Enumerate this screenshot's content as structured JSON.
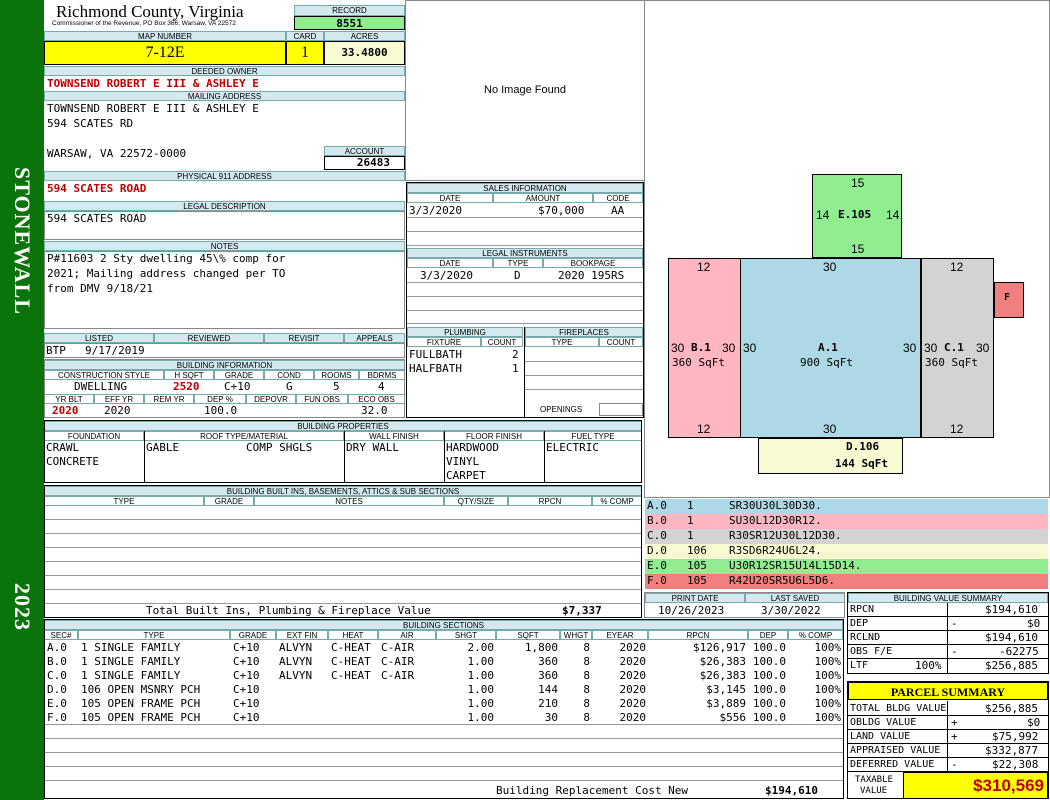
{
  "sidebar": {
    "district": "STONEWALL",
    "year": "2023"
  },
  "header": {
    "county": "Richmond County, Virginia",
    "subtitle": "Commissioner of the Revenue, PO Box 366, Warsaw, VA 22572",
    "record_label": "RECORD",
    "record": "8551",
    "map_label": "MAP NUMBER",
    "map_number": "7-12E",
    "card_label": "CARD",
    "card": "1",
    "acres_label": "ACRES",
    "acres": "33.4800"
  },
  "owner": {
    "deeded_label": "DEEDED OWNER",
    "deeded": "TOWNSEND ROBERT E III & ASHLEY E",
    "mailing_label": "MAILING ADDRESS",
    "mail1": "TOWNSEND ROBERT E III & ASHLEY E",
    "mail2": "594 SCATES RD",
    "mail3": "WARSAW, VA 22572-0000",
    "account_label": "ACCOUNT",
    "account": "26483",
    "phys_label": "PHYSICAL 911 ADDRESS",
    "phys": "594 SCATES ROAD",
    "legal_label": "LEGAL DESCRIPTION",
    "legal": "594 SCATES ROAD",
    "notes_label": "NOTES",
    "notes1": "P#11603 2 Sty dwelling 45\\% comp for",
    "notes2": "2021; Mailing address changed per TO",
    "notes3": "from DMV 9/18/21"
  },
  "image": {
    "text": "No Image Found"
  },
  "sales": {
    "label": "SALES INFORMATION",
    "h_date": "DATE",
    "h_amount": "AMOUNT",
    "h_code": "CODE",
    "date": "3/3/2020",
    "amount": "$70,000",
    "code": "AA"
  },
  "legalinst": {
    "label": "LEGAL INSTRUMENTS",
    "h_date": "DATE",
    "h_type": "TYPE",
    "h_book": "BOOKPAGE",
    "date": "3/3/2020",
    "type": "D",
    "book": "2020 195RS"
  },
  "plumbing": {
    "label": "PLUMBING",
    "h_fixture": "FIXTURE",
    "h_count": "COUNT",
    "r1f": "FULLBATH",
    "r1c": "2",
    "r2f": "HALFBATH",
    "r2c": "1"
  },
  "fireplaces": {
    "label": "FIREPLACES",
    "h_type": "TYPE",
    "h_count": "COUNT",
    "openings": "OPENINGS"
  },
  "visits": {
    "listed_label": "LISTED",
    "reviewed_label": "REVIEWED",
    "revisit_label": "REVISIT",
    "appeals_label": "APPEALS",
    "listed_by": "BTP",
    "listed_date": "9/17/2019"
  },
  "building": {
    "label": "BUILDING INFORMATION",
    "h_style": "CONSTRUCTION STYLE",
    "h_hsqft": "H SQFT",
    "h_grade": "GRADE",
    "h_cond": "COND",
    "h_rooms": "ROOMS",
    "h_bdrms": "BDRMS",
    "style": "DWELLING",
    "hsqft": "2520",
    "grade": "C+10",
    "cond": "G",
    "rooms": "5",
    "bdrms": "4",
    "h_yrblt": "YR BLT",
    "h_effyr": "EFF YR",
    "h_remyr": "REM YR",
    "h_dep": "DEP %",
    "h_depovr": "DEPOVR",
    "h_funobs": "FUN OBS",
    "h_ecoobs": "ECO OBS",
    "yrblt": "2020",
    "effyr": "2020",
    "dep": "100.0",
    "ecoobs": "32.0"
  },
  "props": {
    "label": "BUILDING PROPERTIES",
    "h_found": "FOUNDATION",
    "h_roof": "ROOF TYPE/MATERIAL",
    "h_wall": "WALL FINISH",
    "h_floor": "FLOOR FINISH",
    "h_fuel": "FUEL TYPE",
    "found1": "CRAWL",
    "found2": "CONCRETE",
    "roof1": "GABLE",
    "roof2": "COMP SHGLS",
    "wall": "DRY WALL",
    "floor1": "HARDWOOD",
    "floor2": "VINYL",
    "floor3": "CARPET",
    "fuel": "ELECTRIC"
  },
  "builtins": {
    "label": "BUILDING BUILT INS, BASEMENTS, ATTICS & SUB SECTIONS",
    "h_type": "TYPE",
    "h_grade": "GRADE",
    "h_notes": "NOTES",
    "h_qty": "QTY/SIZE",
    "h_rpcn": "RPCN",
    "h_comp": "% COMP",
    "total_label": "Total Built Ins, Plumbing & Fireplace Value",
    "total": "$7,337"
  },
  "sections": {
    "label": "BUILDING SECTIONS",
    "headers": [
      "SEC#",
      "TYPE",
      "GRADE",
      "EXT FIN",
      "HEAT",
      "AIR",
      "SHGT",
      "SQFT",
      "WHGT",
      "EYEAR",
      "RPCN",
      "DEP",
      "% COMP"
    ],
    "rows": [
      [
        "A.0",
        "1 SINGLE FAMILY",
        "C+10",
        "ALVYN",
        "C-HEAT",
        "C-AIR",
        "2.00",
        "1,800",
        "8",
        "2020",
        "$126,917",
        "100.0",
        "100%"
      ],
      [
        "B.0",
        "1 SINGLE FAMILY",
        "C+10",
        "ALVYN",
        "C-HEAT",
        "C-AIR",
        "1.00",
        "360",
        "8",
        "2020",
        "$26,383",
        "100.0",
        "100%"
      ],
      [
        "C.0",
        "1 SINGLE FAMILY",
        "C+10",
        "ALVYN",
        "C-HEAT",
        "C-AIR",
        "1.00",
        "360",
        "8",
        "2020",
        "$26,383",
        "100.0",
        "100%"
      ],
      [
        "D.0",
        "106 OPEN MSNRY PCH",
        "C+10",
        "",
        "",
        "",
        "1.00",
        "144",
        "8",
        "2020",
        "$3,145",
        "100.0",
        "100%"
      ],
      [
        "E.0",
        "105 OPEN FRAME PCH",
        "C+10",
        "",
        "",
        "",
        "1.00",
        "210",
        "8",
        "2020",
        "$3,889",
        "100.0",
        "100%"
      ],
      [
        "F.0",
        "105 OPEN FRAME PCH",
        "C+10",
        "",
        "",
        "",
        "1.00",
        "30",
        "8",
        "2020",
        "$556",
        "100.0",
        "100%"
      ]
    ],
    "brcn_label": "Building Replacement Cost New",
    "brcn": "$194,610"
  },
  "sketch": {
    "e_top": "15",
    "e_left": "14",
    "e_right": "14",
    "e_bot": "15",
    "e_name": "E.105",
    "b_top": "12",
    "b_left": "30",
    "b_right": "30",
    "b_bot": "12",
    "b_name": "B.1",
    "b_area": "360 SqFt",
    "a_top": "30",
    "a_left": "30",
    "a_right": "30",
    "a_bot": "30",
    "a_name": "A.1",
    "a_area": "900 SqFt",
    "c_top": "12",
    "c_left": "30",
    "c_right": "30",
    "c_bot": "12",
    "c_name": "C.1",
    "c_area": "360 SqFt",
    "f_name": "F",
    "d_name": "D.106",
    "d_area": "144 SqFt"
  },
  "codes": [
    {
      "sec": "A.0",
      "num": "1",
      "code": "SR30U30L30D30.",
      "color": "#add8e6"
    },
    {
      "sec": "B.0",
      "num": "1",
      "code": "SU30L12D30R12.",
      "color": "#ffb6c1"
    },
    {
      "sec": "C.0",
      "num": "1",
      "code": "R30SR12U30L12D30.",
      "color": "#d3d3d3"
    },
    {
      "sec": "D.0",
      "num": "106",
      "code": "R3SD6R24U6L24.",
      "color": "#fafad2"
    },
    {
      "sec": "E.0",
      "num": "105",
      "code": "U30R12SR15U14L15D14.",
      "color": "#90ee90"
    },
    {
      "sec": "F.0",
      "num": "105",
      "code": "R42U20SR5U6L5D6.",
      "color": "#f08080"
    }
  ],
  "dates": {
    "print_label": "PRINT DATE",
    "saved_label": "LAST SAVED",
    "print": "10/26/2023",
    "saved": "3/30/2022"
  },
  "valuesum": {
    "label": "BUILDING VALUE SUMMARY",
    "rpcn_l": "RPCN",
    "rpcn": "$194,610",
    "dep_l": "DEP",
    "dep_s": "-",
    "dep": "$0",
    "rclnd_l": "RCLND",
    "rclnd": "$194,610",
    "obs_l": "OBS F/E",
    "obs_s": "-",
    "obs": "-62275",
    "ltf_l": "LTF",
    "ltf_p": "100%",
    "ltf": "$256,885"
  },
  "parcel": {
    "label": "PARCEL SUMMARY",
    "bldg_l": "TOTAL BLDG VALUE",
    "bldg": "$256,885",
    "obldg_l": "OBLDG VALUE",
    "obldg_s": "+",
    "obldg": "$0",
    "land_l": "LAND VALUE",
    "land_s": "+",
    "land": "$75,992",
    "appr_l": "APPRAISED VALUE",
    "appr": "$332,877",
    "def_l": "DEFERRED VALUE",
    "def_s": "-",
    "def": "$22,308",
    "tax_l1": "TAXABLE",
    "tax_l2": "VALUE",
    "tax": "$310,569"
  }
}
